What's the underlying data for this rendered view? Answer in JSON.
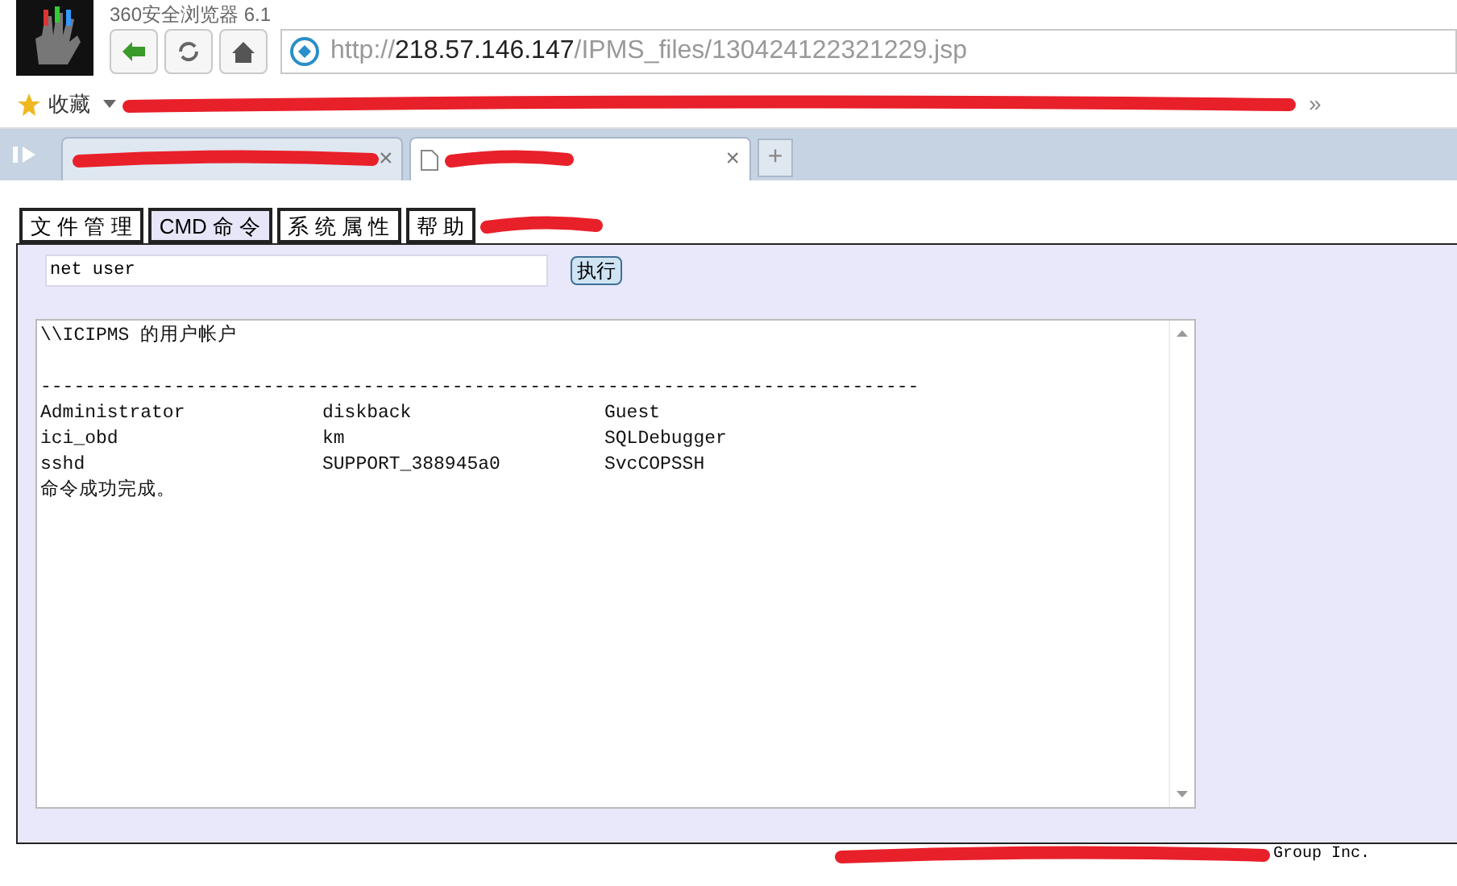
{
  "window": {
    "title": "360安全浏览器 6.1"
  },
  "address_bar": {
    "scheme": "http://",
    "host": "218.57.146.147",
    "path": "/IPMS_files/130424122321229.jsp"
  },
  "bookmarks": {
    "label": "收藏",
    "more": "»"
  },
  "browser_tabs": [
    {
      "selected": false,
      "close": "×"
    },
    {
      "selected": true,
      "close": "×"
    }
  ],
  "new_tab": "+",
  "menu_tabs": [
    {
      "label": "文 件 管 理",
      "selected": false
    },
    {
      "label": "CMD 命 令",
      "selected": true
    },
    {
      "label": "系 统 属 性",
      "selected": false
    },
    {
      "label": "帮 助",
      "selected": false
    }
  ],
  "command": {
    "value": "net user",
    "button": "执行"
  },
  "output": {
    "header": "\\\\ICIPMS 的用户帐户",
    "separator": "-------------------------------------------------------------------------------",
    "rows": [
      [
        "Administrator",
        "diskback",
        "Guest"
      ],
      [
        "ici_obd",
        "km",
        "SQLDebugger"
      ],
      [
        "sshd",
        "SUPPORT_388945a0",
        "SvcCOPSSH"
      ]
    ],
    "footer": "命令成功完成。"
  },
  "page_footer": "Group Inc."
}
